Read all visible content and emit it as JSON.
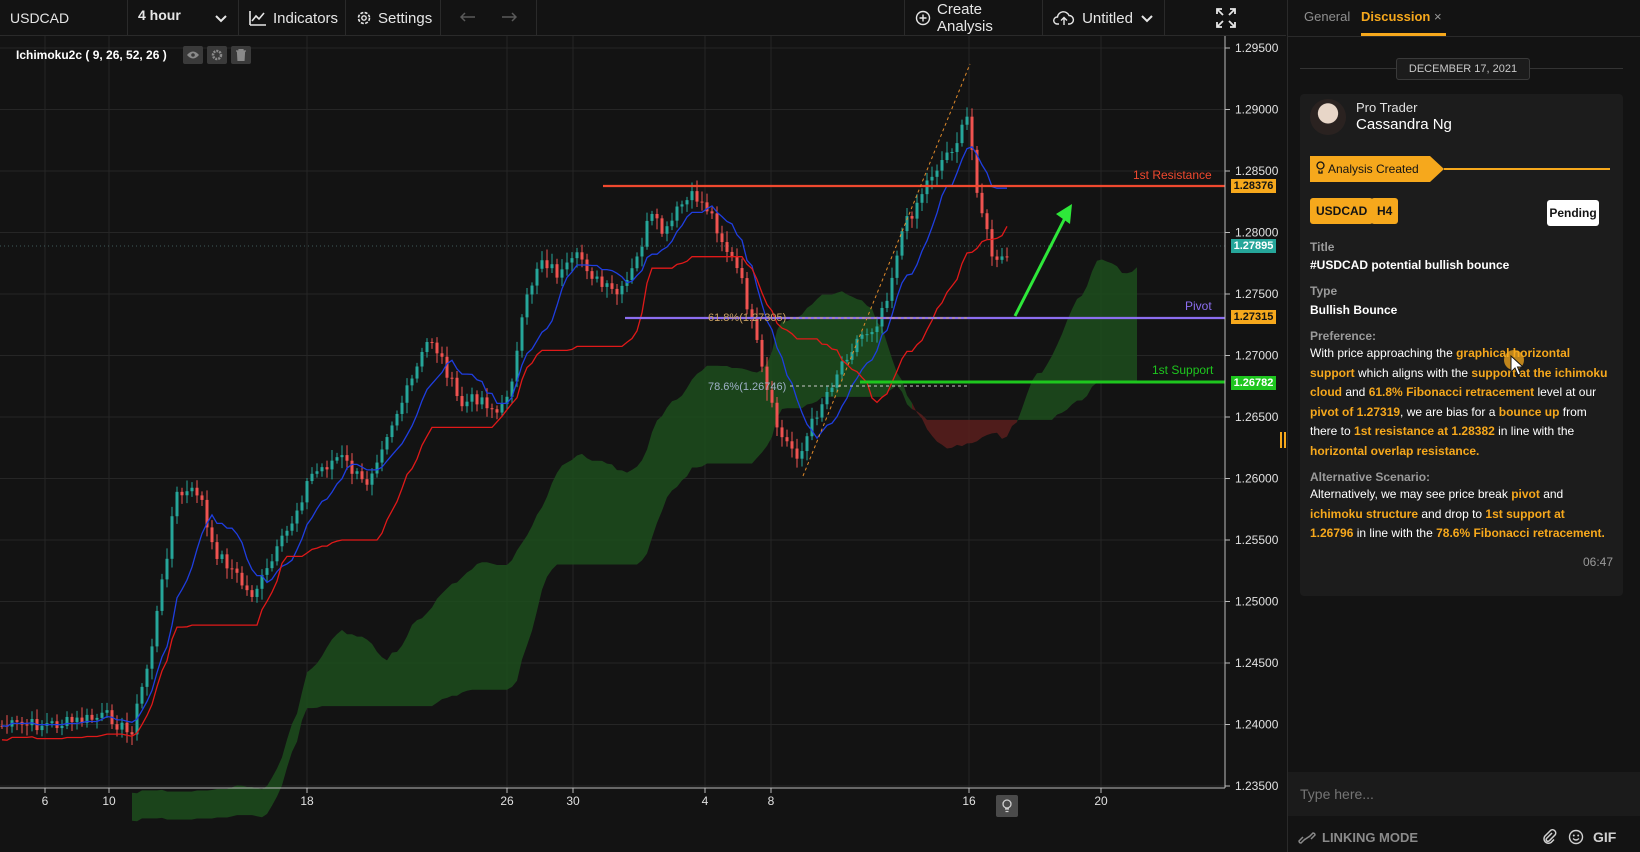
{
  "toolbar": {
    "symbol": "USDCAD",
    "interval": "4 hour",
    "indicators_label": "Indicators",
    "settings_label": "Settings",
    "create_analysis_label": "Create Analysis",
    "layout_name": "Untitled"
  },
  "chart": {
    "indicator_label": "Ichimoku2c ( 9, 26, 52, 26 )",
    "price_axis": [
      "1.29500",
      "1.29000",
      "1.28500",
      "1.28000",
      "1.27500",
      "1.27000",
      "1.26500",
      "1.26000",
      "1.25500",
      "1.25000",
      "1.24500",
      "1.24000",
      "1.23500"
    ],
    "time_axis": [
      "6",
      "10",
      "18",
      "26",
      "30",
      "4",
      "8",
      "16",
      "20"
    ],
    "price_tags": {
      "resistance": "1.28376",
      "current": "1.27895",
      "pivot": "1.27315",
      "support": "1.26782"
    },
    "level_labels": {
      "resistance": "1st Resistance",
      "pivot": "Pivot",
      "support": "1st Support"
    },
    "fib_labels": {
      "f618": "61.8%(1.27305)",
      "f786": "78.6%(1.26746)"
    },
    "colors": {
      "bull": "#26a69a",
      "bear": "#ef5350",
      "resistance": "#f0492f",
      "support": "#1ec61e",
      "pivot": "#8c6ef0",
      "tenkan": "#1f3ee0",
      "kijun": "#e01919",
      "cloud_bull": "#1d4d1d",
      "cloud_bear": "#5a1f1d"
    }
  },
  "panel": {
    "tabs": [
      "General",
      "Discussion"
    ],
    "date": "DECEMBER 17, 2021",
    "author_role": "Pro Trader",
    "author_name": "Cassandra Ng",
    "status_banner": "Analysis Created",
    "badges": [
      "USDCAD",
      "H4"
    ],
    "state_button": "Pending",
    "title_label": "Title",
    "title_value": "#USDCAD potential bullish bounce",
    "type_label": "Type",
    "type_value": "Bullish Bounce",
    "preference_label": "Preference:",
    "preference_text": "With price approaching the graphical horizontal support which aligns with the support at the ichimoku cloud and 61.8% Fibonacci retracement level at our pivot of 1.27319, we are bias for a bounce up from there to 1st resistance at 1.28382 in line with the horizontal overlap resistance.",
    "alt_label": "Alternative Scenario:",
    "alt_text": "Alternatively, we may see price break pivot and ichimoku structure and drop to 1st support at 1.26796 in line with the 78.6% Fibonacci retracement.",
    "time": "06:47",
    "input_placeholder": "Type here...",
    "linking_mode": "LINKING MODE",
    "gif_label": "GIF"
  }
}
